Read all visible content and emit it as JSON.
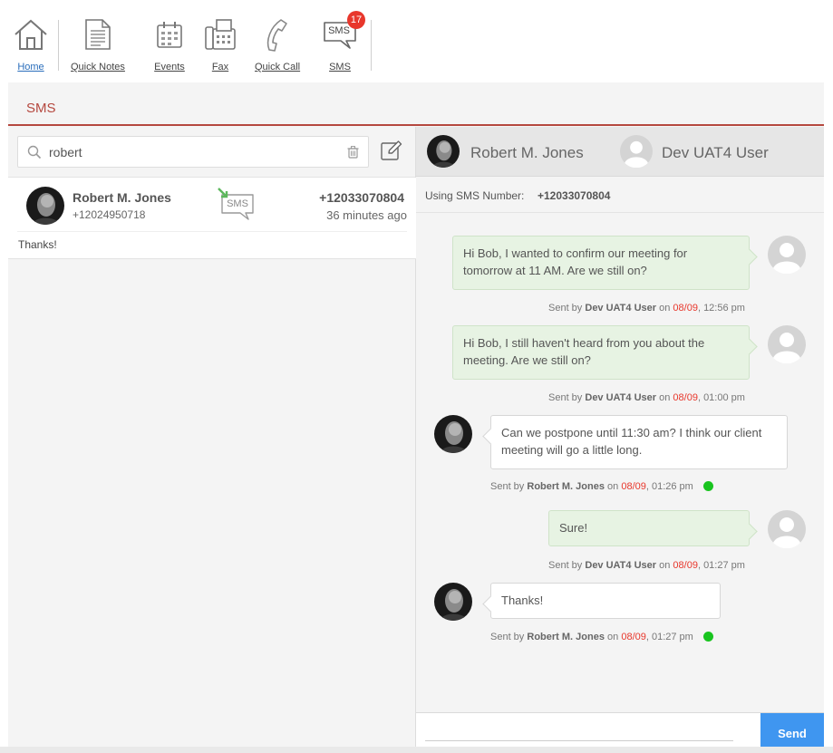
{
  "toolbar": {
    "items": [
      {
        "label": "Home",
        "icon": "home-icon"
      },
      {
        "label": "Quick Notes",
        "icon": "document-icon"
      },
      {
        "label": "Events",
        "icon": "calendar-icon"
      },
      {
        "label": "Fax",
        "icon": "fax-icon"
      },
      {
        "label": "Quick Call",
        "icon": "phone-icon"
      },
      {
        "label": "SMS",
        "icon": "sms-icon",
        "icon_text": "SMS",
        "badge": "17"
      }
    ]
  },
  "panel": {
    "title": "SMS"
  },
  "search": {
    "value": "robert"
  },
  "conversation": {
    "name": "Robert M. Jones",
    "phone": "+12024950718",
    "number": "+12033070804",
    "time": "36 minutes ago",
    "preview": "Thanks!",
    "icon_text": "SMS"
  },
  "chat": {
    "contact_name": "Robert M. Jones",
    "user_name": "Dev UAT4 User",
    "using_label": "Using SMS Number:",
    "using_number": "+12033070804",
    "messages": [
      {
        "direction": "out",
        "text": "Hi Bob, I wanted to confirm our meeting for tomorrow at 11 AM. Are we still on?",
        "sent_by": "Sent by",
        "sender": "Dev UAT4 User",
        "on": "on",
        "date": "08/09",
        "time": ", 12:56 pm"
      },
      {
        "direction": "out",
        "text": "Hi Bob, I still haven't heard from you about the meeting. Are we still on?",
        "sent_by": "Sent by",
        "sender": "Dev UAT4 User",
        "on": "on",
        "date": "08/09",
        "time": ", 01:00 pm"
      },
      {
        "direction": "in",
        "text": "Can we postpone until 11:30 am? I think our client meeting will go a little long.",
        "sent_by": "Sent by",
        "sender": "Robert M. Jones",
        "on": "on",
        "date": "08/09",
        "time": ", 01:26 pm"
      },
      {
        "direction": "out",
        "text": "Sure!",
        "sent_by": "Sent by",
        "sender": "Dev UAT4 User",
        "on": "on",
        "date": "08/09",
        "time": ", 01:27 pm"
      },
      {
        "direction": "in",
        "text": "Thanks!",
        "sent_by": "Sent by",
        "sender": "Robert M. Jones",
        "on": "on",
        "date": "08/09",
        "time": ", 01:27 pm"
      }
    ],
    "send_label": "Send"
  },
  "colors": {
    "accent": "#b5483f",
    "send": "#3f96f0",
    "badge": "#e8372c",
    "online": "#19c41f",
    "out_bubble": "#e7f3e3"
  }
}
